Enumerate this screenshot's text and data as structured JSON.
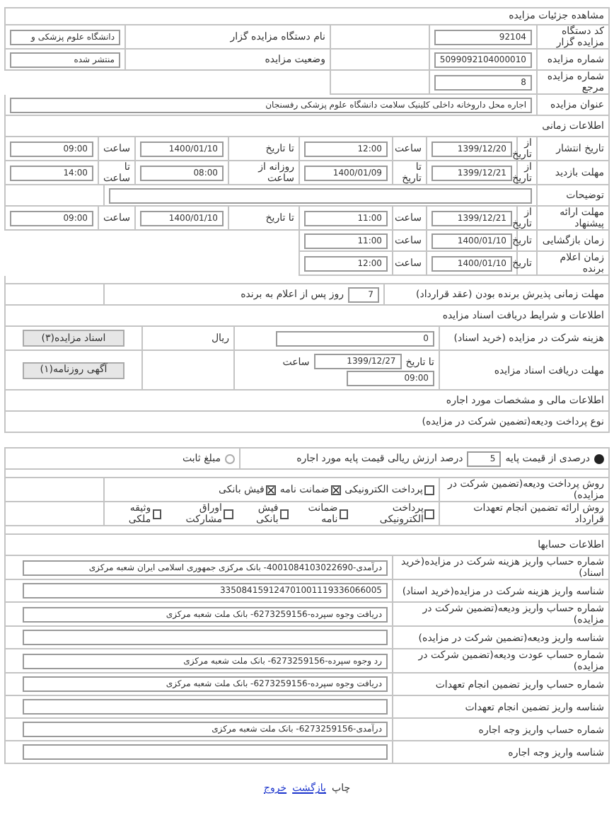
{
  "title": "مشاهده جزئیات مزایده",
  "rows": [
    {
      "kind": "pair",
      "label": "کد دستگاه مزایده گزار",
      "value": "92104",
      "label2": "نام دستگاه مزایده گزار",
      "value2": "دانشگاه علوم پزشکی و"
    },
    {
      "kind": "pair",
      "label": "شماره مزایده",
      "value": "5099092104000010",
      "label2": "وضعیت مزایده",
      "value2": "منتشر شده"
    },
    {
      "kind": "pair",
      "label": "شماره مزایده مرجع",
      "value": "8"
    },
    {
      "kind": "wide",
      "label": "عنوان مزایده",
      "value": "اجاره محل داروخانه داخلی کلینیک سلامت دانشگاه علوم پزشکی رفسنجان"
    },
    {
      "kind": "section",
      "label": "اطلاعات زمانی"
    },
    {
      "kind": "range",
      "label": "تاریخ انتشار",
      "items": [
        {
          "kind": "text",
          "text": "از تاریخ"
        },
        {
          "kind": "field",
          "text": "1399/12/20"
        },
        {
          "kind": "text",
          "text": "ساعت"
        },
        {
          "kind": "field",
          "text": "12:00"
        },
        {
          "kind": "text",
          "text": "تا تاریخ"
        },
        {
          "kind": "field",
          "text": "1400/01/10"
        },
        {
          "kind": "text",
          "text": "ساعت"
        },
        {
          "kind": "field",
          "text": "09:00"
        }
      ]
    },
    {
      "kind": "range",
      "label": "مهلت بازدید",
      "items": [
        {
          "kind": "text",
          "text": "از تاریخ"
        },
        {
          "kind": "field",
          "text": "1399/12/21"
        },
        {
          "kind": "text",
          "text": "تا تاریخ"
        },
        {
          "kind": "field",
          "text": "1400/01/09"
        },
        {
          "kind": "text",
          "text": "روزانه از ساعت"
        },
        {
          "kind": "field",
          "text": "08:00"
        },
        {
          "kind": "text",
          "text": "تا ساعت"
        },
        {
          "kind": "field",
          "text": "14:00"
        }
      ]
    },
    {
      "kind": "wide",
      "label": "توضیحات"
    },
    {
      "kind": "range",
      "label": "مهلت ارائه پیشنهاد",
      "items": [
        {
          "kind": "text",
          "text": "از تاریخ"
        },
        {
          "kind": "field",
          "text": "1399/12/21"
        },
        {
          "kind": "text",
          "text": "ساعت"
        },
        {
          "kind": "field",
          "text": "11:00"
        },
        {
          "kind": "text",
          "text": "تا تاریخ"
        },
        {
          "kind": "field",
          "text": "1400/01/10"
        },
        {
          "kind": "text",
          "text": "ساعت"
        },
        {
          "kind": "field",
          "text": "09:00"
        }
      ]
    },
    {
      "kind": "range",
      "label": "زمان بازگشایی",
      "items": [
        {
          "kind": "text",
          "text": "تاریخ"
        },
        {
          "kind": "field",
          "text": "1400/01/10"
        },
        {
          "kind": "text",
          "text": "ساعت"
        },
        {
          "kind": "field",
          "text": "11:00"
        }
      ]
    },
    {
      "kind": "range",
      "label": "زمان اعلام برنده",
      "items": [
        {
          "kind": "text",
          "text": "تاریخ"
        },
        {
          "kind": "field",
          "text": "1400/01/10"
        },
        {
          "kind": "text",
          "text": "ساعت"
        },
        {
          "kind": "field",
          "text": "12:00"
        }
      ]
    },
    {
      "kind": "spacer"
    },
    {
      "kind": "deadline",
      "label": "مهلت زمانی پذیرش برنده بودن (عقد قرارداد)",
      "value": "7",
      "suffix": "روز پس از اعلام به برنده"
    },
    {
      "kind": "section",
      "label": "اطلاعات و شرایط دریافت اسناد مزایده"
    },
    {
      "kind": "fee",
      "label": "هزینه شرکت در مزایده (خرید اسناد)",
      "items": [
        {
          "kind": "field",
          "text": "0"
        }
      ],
      "unit": "ریال",
      "button": "اسناد مزایده(۳)"
    },
    {
      "kind": "fee",
      "label": "مهلت دریافت اسناد مزایده",
      "items": [
        {
          "kind": "text",
          "text": "تا تاریخ"
        },
        {
          "kind": "field",
          "text": "1399/12/27"
        },
        {
          "kind": "text",
          "text": "ساعت"
        },
        {
          "kind": "field",
          "text": "09:00"
        }
      ],
      "button": "آگهی روزنامه(۱)"
    },
    {
      "kind": "section",
      "label": "اطلاعات مالی و مشخصات مورد اجاره"
    },
    {
      "kind": "section",
      "label": "نوع پرداخت ودیعه(تضمین شرکت در مزایده)"
    },
    {
      "kind": "radio",
      "options": [
        {
          "label": "درصدی از قیمت پایه",
          "selected": true,
          "value": "5",
          "suffix": "درصد ارزش ریالی قیمت پایه مورد اجاره"
        },
        {
          "label": "مبلغ ثابت",
          "selected": false
        }
      ]
    },
    {
      "kind": "spacer"
    },
    {
      "kind": "checks",
      "label": "روش پرداخت ودیعه(تضمین شرکت در مزایده)",
      "options": [
        {
          "label": "پرداخت الکترونیکی",
          "checked": false
        },
        {
          "label": "ضمانت نامه",
          "checked": true
        },
        {
          "label": "فیش بانکی",
          "checked": true
        }
      ]
    },
    {
      "kind": "checks",
      "label": "روش ارائه تضمین انجام تعهدات قرارداد",
      "options": [
        {
          "label": "پرداخت الکترونیکی",
          "checked": false
        },
        {
          "label": "ضمانت نامه",
          "checked": false
        },
        {
          "label": "فیش بانکی",
          "checked": false
        },
        {
          "label": "اوراق مشارکت",
          "checked": false
        },
        {
          "label": "وثیقه ملکی",
          "checked": false
        }
      ]
    },
    {
      "kind": "spacer"
    },
    {
      "kind": "section",
      "label": "اطلاعات حسابها"
    },
    {
      "kind": "account",
      "label": "شماره حساب واریز هزینه شرکت در مزایده(خرید اسناد)",
      "value": "درآمدی-4001084103022690- بانک مرکزی جمهوری اسلامی ایران شعبه مرکزی"
    },
    {
      "kind": "account",
      "label": "شناسه واریز هزینه شرکت در مزایده(خرید اسناد)",
      "value": "335084159124701001119336066005"
    },
    {
      "kind": "account",
      "label": "شماره حساب واریز ودیعه(تضمین شرکت در مزایده)",
      "value": "دریافت وجوه سپرده-6273259156- بانک ملت شعبه مرکزی"
    },
    {
      "kind": "account",
      "label": "شناسه واریز ودیعه(تضمین شرکت در مزایده)"
    },
    {
      "kind": "account",
      "label": "شماره حساب عودت ودیعه(تضمین شرکت در مزایده)",
      "value": "رد وجوه سپرده-6273259156- بانک ملت شعبه مرکزی"
    },
    {
      "kind": "account",
      "label": "شماره حساب واریز تضمین انجام تعهدات",
      "value": "دریافت وجوه سپرده-6273259156- بانک ملت شعبه مرکزی"
    },
    {
      "kind": "account",
      "label": "شناسه واریز تضمین انجام تعهدات"
    },
    {
      "kind": "account",
      "label": "شماره حساب واریز وجه اجاره",
      "value": "درآمدی-6273259156- بانک ملت شعبه مرکزی"
    },
    {
      "kind": "account",
      "label": "شناسه واریز وجه اجاره"
    }
  ],
  "footer_links": [
    {
      "label": "چاپ",
      "kind": "plain"
    },
    {
      "label": "بازگشت",
      "kind": "link"
    },
    {
      "label": "خروج",
      "kind": "link"
    }
  ]
}
